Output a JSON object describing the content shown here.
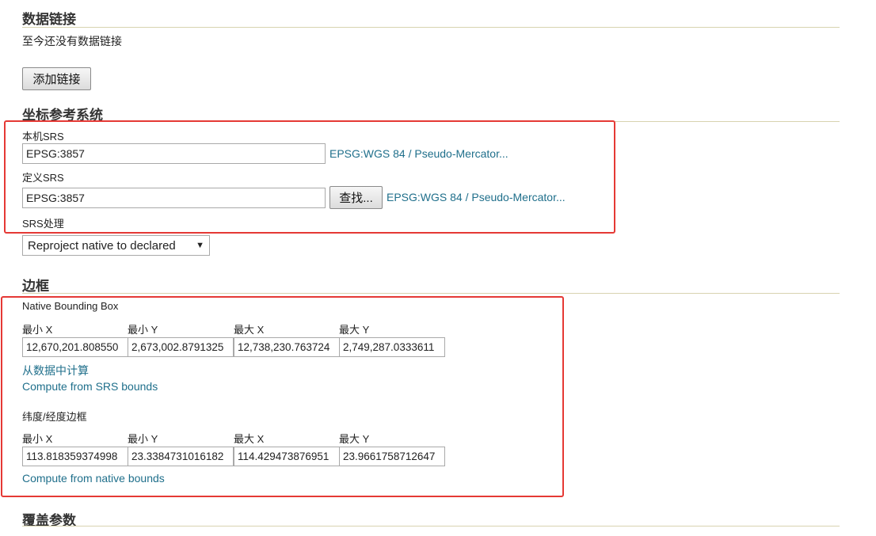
{
  "data_links": {
    "title": "数据链接",
    "empty_text": "至今还没有数据链接",
    "add_button": "添加链接"
  },
  "crs": {
    "title": "坐标参考系统",
    "native_label": "本机SRS",
    "native_value": "EPSG:3857",
    "native_link": "EPSG:WGS 84 / Pseudo-Mercator...",
    "declared_label": "定义SRS",
    "declared_value": "EPSG:3857",
    "find_button": "查找...",
    "declared_link": "EPSG:WGS 84 / Pseudo-Mercator...",
    "handling_label": "SRS处理",
    "handling_selected": "Reproject native to declared"
  },
  "bbox": {
    "title": "边框",
    "native_label": "Native Bounding Box",
    "columns": [
      "最小 X",
      "最小 Y",
      "最大 X",
      "最大 Y"
    ],
    "native_values": [
      "12,670,201.808550",
      "2,673,002.8791325",
      "12,738,230.763724",
      "2,749,287.0333611"
    ],
    "compute_from_data": "从数据中计算",
    "compute_from_srs": "Compute from SRS bounds",
    "latlon_label": "纬度/经度边框",
    "latlon_columns": [
      "最小 X",
      "最小 Y",
      "最大 X",
      "最大 Y"
    ],
    "latlon_values": [
      "113.818359374998",
      "23.3384731016182",
      "114.429473876951",
      "23.9661758712647"
    ],
    "compute_from_native": "Compute from native bounds"
  },
  "coverage": {
    "title": "覆盖参数"
  },
  "colors": {
    "link": "#1f6f8b",
    "highlight": "#e53935",
    "rule": "#d8d3b0"
  }
}
